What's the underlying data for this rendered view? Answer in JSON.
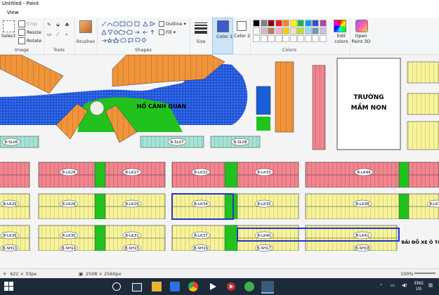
{
  "window": {
    "title": "Untitled - Paint"
  },
  "menu": {
    "view": "View"
  },
  "ribbon": {
    "image": {
      "select": "Select",
      "crop": "Crop",
      "resize": "Resize",
      "rotate": "Rotate",
      "label": "Image"
    },
    "tools": {
      "label": "Tools"
    },
    "brushes": {
      "label": "Brushes"
    },
    "shapes": {
      "outline": "Outline",
      "fill": "Fill",
      "label": "Shapes"
    },
    "size": {
      "label": "Size"
    },
    "color1": {
      "label": "Color 1",
      "value": "#3c5bd1"
    },
    "color2": {
      "label": "Color 2",
      "value": "#ffffff"
    },
    "colors": {
      "label": "Colors"
    },
    "edit_colors": {
      "label": "Edit colors"
    },
    "paint3d": {
      "label": "Open Paint 3D"
    }
  },
  "palette": [
    "#000000",
    "#7f7f7f",
    "#880015",
    "#ed1c24",
    "#ff7f27",
    "#fff200",
    "#22b14c",
    "#00a2e8",
    "#3f48cc",
    "#a349a4",
    "#ffffff",
    "#c3c3c3",
    "#b97a57",
    "#ffaec9",
    "#ffc90e",
    "#efe4b0",
    "#b5e61d",
    "#99d9ea",
    "#7092be",
    "#c8bfe7",
    "#ffffff",
    "#ffffff",
    "#ffffff",
    "#ffffff",
    "#ffffff",
    "#ffffff",
    "#ffffff",
    "#ffffff",
    "#ffffff",
    "#ffffff"
  ],
  "map": {
    "lake_label": "HỒ CẢNH QUAN",
    "school_label_1": "TRƯỜNG",
    "school_label_2": "MẦM NON",
    "parking_label": "BÃI ĐỖ XE Ô TÔ",
    "labels": {
      "sl06": "B-SL06",
      "sl07": "B-SL07",
      "sl08": "B-SL08",
      "lk26": "B-LK26",
      "lk27": "B-LK27",
      "lk28": "B-LK28",
      "lk31": "B-LK31",
      "lk32": "B-LK32",
      "lk33": "B-LK33",
      "lk29": "B-LK29",
      "lk30": "B-LK30",
      "lk34": "B-LK34",
      "lk35": "B-LK35",
      "lk36": "B-LK36",
      "lk37": "B-LK37",
      "lk38": "B-LK38",
      "lk39": "B-LK39",
      "lk40": "B-LK40",
      "lk41": "B-LK41",
      "lk42": "B-LK42",
      "lk43": "B-LK43",
      "lk44": "B-LK44",
      "lk45": "B-LK45",
      "lk46": "B-LK46",
      "lk47": "B-LK47",
      "sh13": "B-SH13",
      "sh14": "B-SH14",
      "sh15": "B-SH15",
      "sh16": "B-SH16",
      "sh17": "B-SH17",
      "sh18": "B-SH18"
    }
  },
  "status": {
    "cursor": "422 × 33px",
    "size": "2508 × 2560px",
    "zoom": "100%"
  },
  "taskbar": {
    "lang1": "ENG",
    "lang2": "US"
  }
}
